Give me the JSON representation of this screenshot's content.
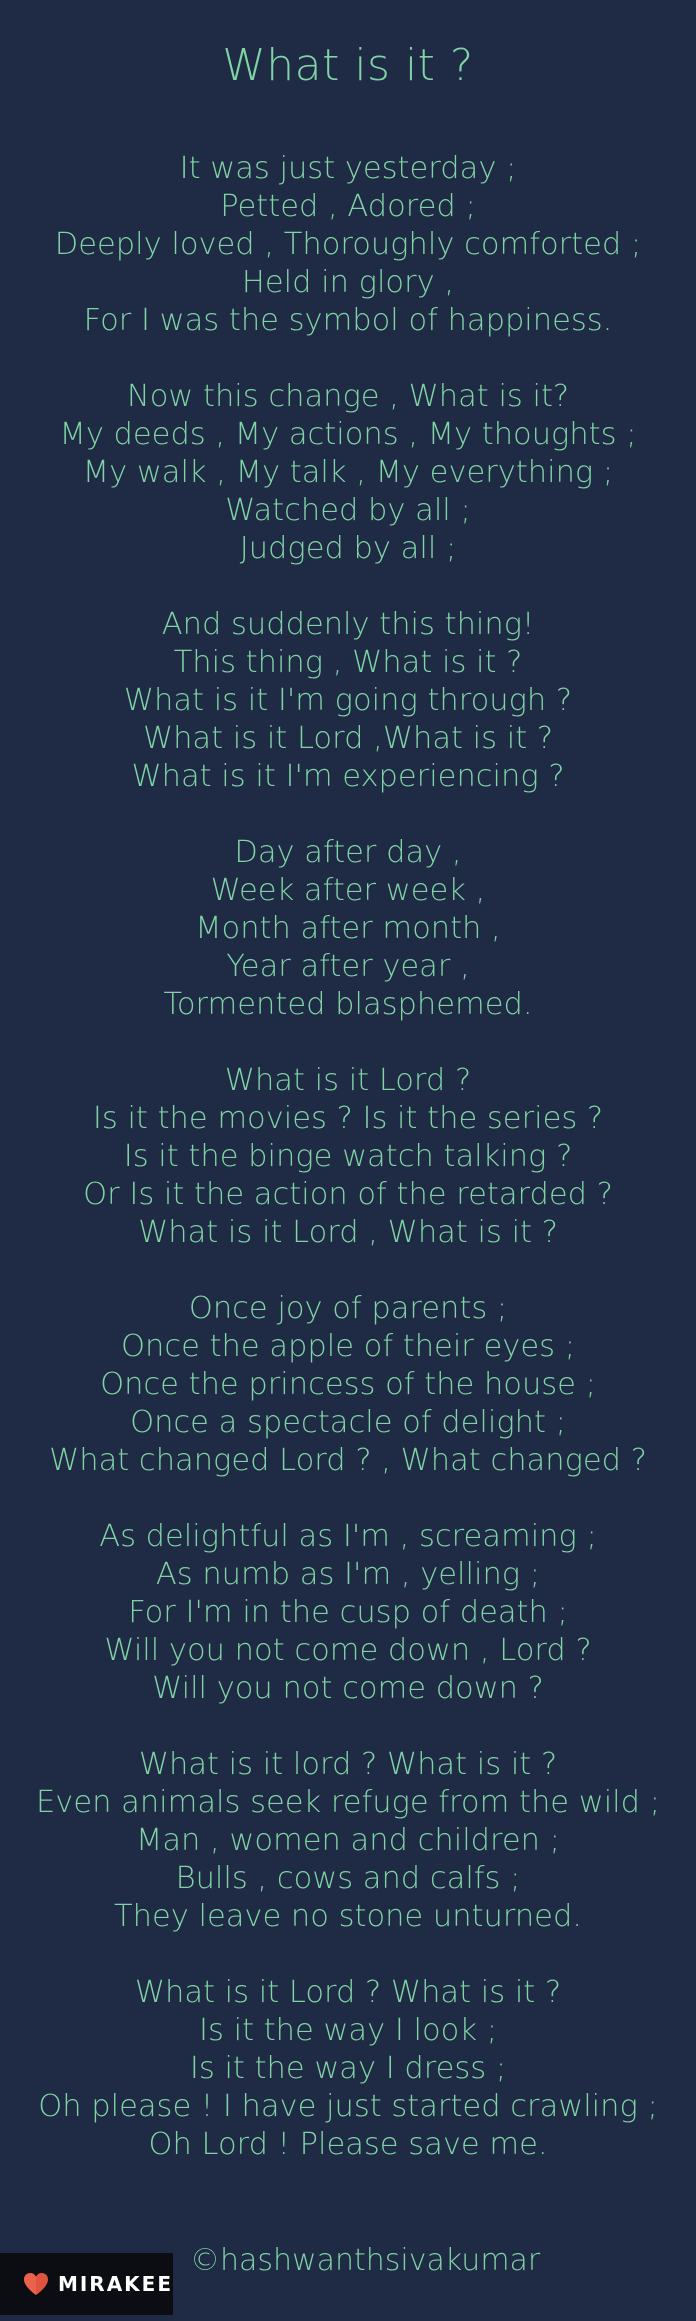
{
  "title": "What is it ?",
  "stanzas": [
    [
      "It was just yesterday ;",
      "Petted , Adored ;",
      "Deeply loved , Thoroughly comforted ;",
      "Held in glory ,",
      "For I was the symbol of happiness."
    ],
    [
      "Now this change , What is it?",
      "My deeds , My actions , My thoughts ;",
      "My walk , My talk , My everything ;",
      "Watched by all ;",
      "Judged by all ;"
    ],
    [
      "And suddenly this thing!",
      "This thing , What is it ?",
      "What is it I'm going through ?",
      "What is it Lord ,What is it ?",
      "What is it I'm experiencing ?"
    ],
    [
      "Day after day ,",
      "Week after week ,",
      "Month after month ,",
      "Year after year ,",
      "Tormented blasphemed."
    ],
    [
      "What is it Lord ?",
      "Is it the movies ? Is it the series ?",
      "Is it the binge watch talking ?",
      "Or Is it the action of the retarded ?",
      "What is it Lord , What is it ?"
    ],
    [
      "Once joy of parents ;",
      "Once the apple of their eyes ;",
      "Once the princess of the house ;",
      "Once a spectacle of delight ;",
      "What changed Lord ? , What changed ?"
    ],
    [
      "As delightful as I'm , screaming ;",
      "As numb as I'm , yelling ;",
      "For I'm in the cusp of death ;",
      "Will you not come down , Lord ?",
      "Will you not come down ?"
    ],
    [
      "What is it lord ? What is it ?",
      "Even animals seek refuge from the wild ;",
      "Man , women and children ;",
      "Bulls , cows and calfs ;",
      "They leave no stone unturned."
    ],
    [
      "What is it Lord ? What is it ?",
      "Is it the way I look ;",
      "Is it the way I dress ;",
      "Oh please ! I have just started crawling ;",
      "Oh Lord ! Please save me."
    ]
  ],
  "author": "©hashwanthsivakumar",
  "brand": {
    "name": "MIRAKEE",
    "icon": "heart-icon",
    "icon_color": "#e0533f"
  },
  "colors": {
    "background": "#1f2a44",
    "text": "#7fd3a5"
  }
}
